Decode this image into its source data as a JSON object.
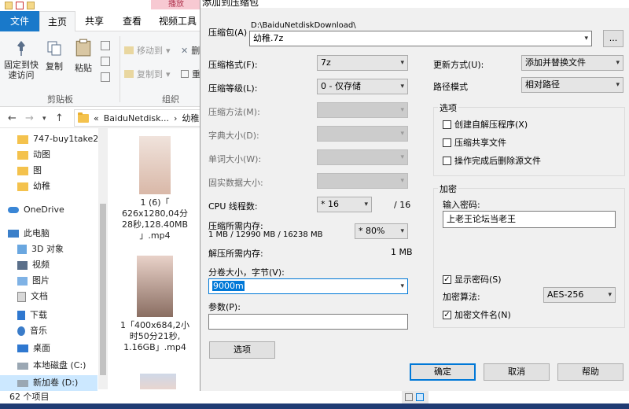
{
  "explorer": {
    "context_tab": "播放",
    "tabs": {
      "file": "文件",
      "home": "主页",
      "share": "共享",
      "view": "查看",
      "video_tools": "视频工具"
    },
    "ribbon": {
      "pin": "固定到快\n速访问",
      "copy": "复制",
      "paste": "粘贴",
      "move_to": "移动到",
      "copy_to": "复制到",
      "delete_partial": "删",
      "rename_partial": "重",
      "group_clipboard": "剪贴板",
      "group_organize": "组织"
    },
    "address": {
      "prefix": "«",
      "path1": "BaiduNetdisk...",
      "path2": "幼稚"
    },
    "nav_items": [
      {
        "label": "747-buy1take2",
        "icon": "folder-icon"
      },
      {
        "label": "动图",
        "icon": "folder-icon"
      },
      {
        "label": "图",
        "icon": "folder-icon"
      },
      {
        "label": "幼稚",
        "icon": "folder-icon"
      },
      {
        "label": "OneDrive",
        "icon": "cloud-icon"
      },
      {
        "label": "此电脑",
        "icon": "computer-icon"
      },
      {
        "label": "3D 对象",
        "icon": "cube-icon"
      },
      {
        "label": "视频",
        "icon": "video-icon"
      },
      {
        "label": "图片",
        "icon": "picture-icon"
      },
      {
        "label": "文档",
        "icon": "document-icon"
      },
      {
        "label": "下载",
        "icon": "download-icon"
      },
      {
        "label": "音乐",
        "icon": "music-icon"
      },
      {
        "label": "桌面",
        "icon": "desktop-icon"
      },
      {
        "label": "本地磁盘 (C:)",
        "icon": "drive-icon"
      },
      {
        "label": "新加卷 (D:)",
        "icon": "drive-icon"
      }
    ],
    "files": [
      {
        "lines": [
          "1 (6)「",
          "626x1280,04分",
          "28秒,128.40MB",
          "」.mp4"
        ]
      },
      {
        "lines": [
          "1「400x684,2小",
          "时50分21秒,",
          "1.16GB」.mp4"
        ]
      }
    ],
    "status": "62 个项目"
  },
  "dialog": {
    "title": "添加到压缩包",
    "archive_label": "压缩包(A)",
    "archive_dir": "D:\\BaiduNetdiskDownload\\",
    "archive_name": "幼稚.7z",
    "browse": "...",
    "format_label": "压缩格式(F):",
    "format_value": "7z",
    "level_label": "压缩等级(L):",
    "level_value": "0 - 仅存储",
    "method_label": "压缩方法(M):",
    "dict_label": "字典大小(D):",
    "word_label": "单词大小(W):",
    "solid_label": "固实数据大小:",
    "cpu_label": "CPU 线程数:",
    "cpu_value": "* 16",
    "cpu_total": "/ 16",
    "mem_label": "压缩所需内存:",
    "mem_detail": "1 MB / 12990 MB / 16238 MB",
    "mem_value": "* 80%",
    "decomp_label": "解压所需内存:",
    "decomp_value": "1 MB",
    "split_label": "分卷大小，字节(V):",
    "split_value": "9000m",
    "params_label": "参数(P):",
    "params_value": "",
    "options_button": "选项",
    "update_label": "更新方式(U):",
    "update_value": "添加并替换文件",
    "path_label": "路径模式",
    "path_value": "相对路径",
    "options_group": "选项",
    "opt_sfx": "创建自解压程序(X)",
    "opt_shared": "压缩共享文件",
    "opt_delete": "操作完成后删除源文件",
    "encrypt_group": "加密",
    "password_label": "输入密码:",
    "password_value": "上老王论坛当老王",
    "show_password": "显示密码(S)",
    "enc_method_label": "加密算法:",
    "enc_method_value": "AES-256",
    "enc_names": "加密文件名(N)",
    "ok": "确定",
    "cancel": "取消",
    "help": "帮助"
  }
}
